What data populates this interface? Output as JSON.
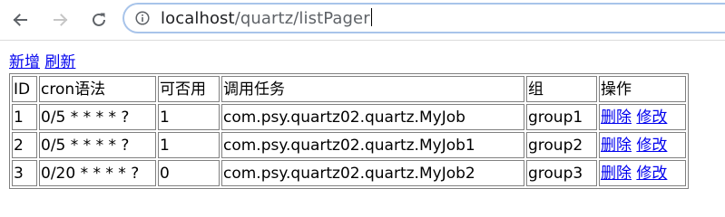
{
  "browser": {
    "back_icon": "arrow-left-icon",
    "forward_icon": "arrow-right-icon",
    "reload_icon": "reload-icon",
    "info_icon": "info-circle-icon",
    "url_host": "localhost",
    "url_path": "/quartz/listPager"
  },
  "page": {
    "add_link": "新增",
    "refresh_link": "刷新",
    "table": {
      "headers": [
        "ID",
        "cron语法",
        "可否用",
        "调用任务",
        "组",
        "操作"
      ],
      "rows": [
        {
          "id": "1",
          "cron": "0/5 * * * * ?",
          "enabled": "1",
          "task": "com.psy.quartz02.quartz.MyJob",
          "group": "group1",
          "delete": "删除",
          "edit": "修改"
        },
        {
          "id": "2",
          "cron": "0/5 * * * * ?",
          "enabled": "1",
          "task": "com.psy.quartz02.quartz.MyJob1",
          "group": "group2",
          "delete": "删除",
          "edit": "修改"
        },
        {
          "id": "3",
          "cron": "0/20 * * * * ?",
          "enabled": "0",
          "task": "com.psy.quartz02.quartz.MyJob2",
          "group": "group3",
          "delete": "删除",
          "edit": "修改"
        }
      ]
    }
  }
}
